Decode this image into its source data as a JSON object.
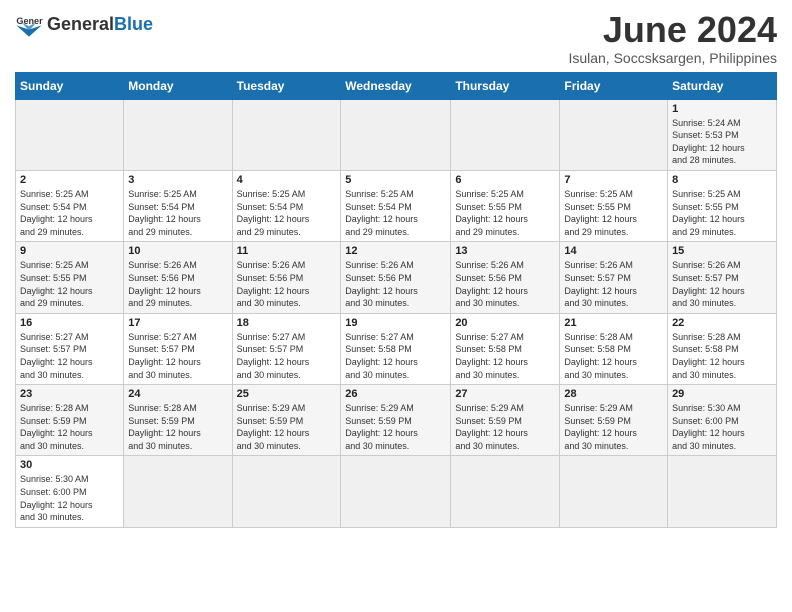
{
  "header": {
    "logo_general": "General",
    "logo_blue": "Blue",
    "month_title": "June 2024",
    "subtitle": "Isulan, Soccsksargen, Philippines"
  },
  "days_of_week": [
    "Sunday",
    "Monday",
    "Tuesday",
    "Wednesday",
    "Thursday",
    "Friday",
    "Saturday"
  ],
  "weeks": [
    [
      {
        "day": "",
        "info": ""
      },
      {
        "day": "",
        "info": ""
      },
      {
        "day": "",
        "info": ""
      },
      {
        "day": "",
        "info": ""
      },
      {
        "day": "",
        "info": ""
      },
      {
        "day": "",
        "info": ""
      },
      {
        "day": "1",
        "info": "Sunrise: 5:24 AM\nSunset: 5:53 PM\nDaylight: 12 hours\nand 28 minutes."
      }
    ],
    [
      {
        "day": "2",
        "info": "Sunrise: 5:25 AM\nSunset: 5:54 PM\nDaylight: 12 hours\nand 29 minutes."
      },
      {
        "day": "3",
        "info": "Sunrise: 5:25 AM\nSunset: 5:54 PM\nDaylight: 12 hours\nand 29 minutes."
      },
      {
        "day": "4",
        "info": "Sunrise: 5:25 AM\nSunset: 5:54 PM\nDaylight: 12 hours\nand 29 minutes."
      },
      {
        "day": "5",
        "info": "Sunrise: 5:25 AM\nSunset: 5:54 PM\nDaylight: 12 hours\nand 29 minutes."
      },
      {
        "day": "6",
        "info": "Sunrise: 5:25 AM\nSunset: 5:55 PM\nDaylight: 12 hours\nand 29 minutes."
      },
      {
        "day": "7",
        "info": "Sunrise: 5:25 AM\nSunset: 5:55 PM\nDaylight: 12 hours\nand 29 minutes."
      },
      {
        "day": "8",
        "info": "Sunrise: 5:25 AM\nSunset: 5:55 PM\nDaylight: 12 hours\nand 29 minutes."
      }
    ],
    [
      {
        "day": "9",
        "info": "Sunrise: 5:25 AM\nSunset: 5:55 PM\nDaylight: 12 hours\nand 29 minutes."
      },
      {
        "day": "10",
        "info": "Sunrise: 5:26 AM\nSunset: 5:56 PM\nDaylight: 12 hours\nand 29 minutes."
      },
      {
        "day": "11",
        "info": "Sunrise: 5:26 AM\nSunset: 5:56 PM\nDaylight: 12 hours\nand 30 minutes."
      },
      {
        "day": "12",
        "info": "Sunrise: 5:26 AM\nSunset: 5:56 PM\nDaylight: 12 hours\nand 30 minutes."
      },
      {
        "day": "13",
        "info": "Sunrise: 5:26 AM\nSunset: 5:56 PM\nDaylight: 12 hours\nand 30 minutes."
      },
      {
        "day": "14",
        "info": "Sunrise: 5:26 AM\nSunset: 5:57 PM\nDaylight: 12 hours\nand 30 minutes."
      },
      {
        "day": "15",
        "info": "Sunrise: 5:26 AM\nSunset: 5:57 PM\nDaylight: 12 hours\nand 30 minutes."
      }
    ],
    [
      {
        "day": "16",
        "info": "Sunrise: 5:27 AM\nSunset: 5:57 PM\nDaylight: 12 hours\nand 30 minutes."
      },
      {
        "day": "17",
        "info": "Sunrise: 5:27 AM\nSunset: 5:57 PM\nDaylight: 12 hours\nand 30 minutes."
      },
      {
        "day": "18",
        "info": "Sunrise: 5:27 AM\nSunset: 5:57 PM\nDaylight: 12 hours\nand 30 minutes."
      },
      {
        "day": "19",
        "info": "Sunrise: 5:27 AM\nSunset: 5:58 PM\nDaylight: 12 hours\nand 30 minutes."
      },
      {
        "day": "20",
        "info": "Sunrise: 5:27 AM\nSunset: 5:58 PM\nDaylight: 12 hours\nand 30 minutes."
      },
      {
        "day": "21",
        "info": "Sunrise: 5:28 AM\nSunset: 5:58 PM\nDaylight: 12 hours\nand 30 minutes."
      },
      {
        "day": "22",
        "info": "Sunrise: 5:28 AM\nSunset: 5:58 PM\nDaylight: 12 hours\nand 30 minutes."
      }
    ],
    [
      {
        "day": "23",
        "info": "Sunrise: 5:28 AM\nSunset: 5:59 PM\nDaylight: 12 hours\nand 30 minutes."
      },
      {
        "day": "24",
        "info": "Sunrise: 5:28 AM\nSunset: 5:59 PM\nDaylight: 12 hours\nand 30 minutes."
      },
      {
        "day": "25",
        "info": "Sunrise: 5:29 AM\nSunset: 5:59 PM\nDaylight: 12 hours\nand 30 minutes."
      },
      {
        "day": "26",
        "info": "Sunrise: 5:29 AM\nSunset: 5:59 PM\nDaylight: 12 hours\nand 30 minutes."
      },
      {
        "day": "27",
        "info": "Sunrise: 5:29 AM\nSunset: 5:59 PM\nDaylight: 12 hours\nand 30 minutes."
      },
      {
        "day": "28",
        "info": "Sunrise: 5:29 AM\nSunset: 5:59 PM\nDaylight: 12 hours\nand 30 minutes."
      },
      {
        "day": "29",
        "info": "Sunrise: 5:30 AM\nSunset: 6:00 PM\nDaylight: 12 hours\nand 30 minutes."
      }
    ],
    [
      {
        "day": "30",
        "info": "Sunrise: 5:30 AM\nSunset: 6:00 PM\nDaylight: 12 hours\nand 30 minutes."
      },
      {
        "day": "",
        "info": ""
      },
      {
        "day": "",
        "info": ""
      },
      {
        "day": "",
        "info": ""
      },
      {
        "day": "",
        "info": ""
      },
      {
        "day": "",
        "info": ""
      },
      {
        "day": "",
        "info": ""
      }
    ]
  ]
}
